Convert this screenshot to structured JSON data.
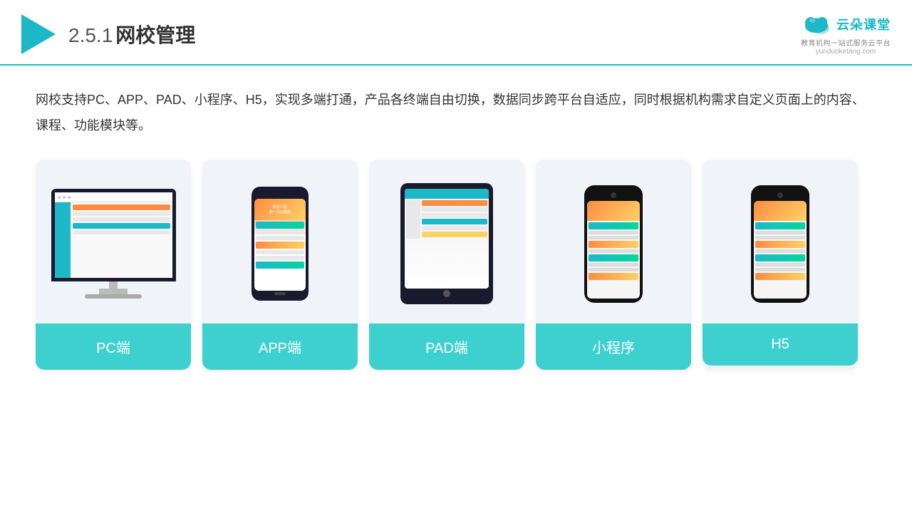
{
  "header": {
    "title": "网校管理",
    "title_number": "2.5.1",
    "logo_text": "云朵课堂",
    "logo_sub": "教育机构一站式服务云平台",
    "logo_url": "yunduoketang.com"
  },
  "description": "网校支持PC、APP、PAD、小程序、H5，实现多端打通，产品各终端自由切换，数据同步跨平台自适应，同时根据机构需求自定义页面上的内容、课程、功能模块等。",
  "cards": [
    {
      "id": "pc",
      "label": "PC端"
    },
    {
      "id": "app",
      "label": "APP端"
    },
    {
      "id": "pad",
      "label": "PAD端"
    },
    {
      "id": "miniprogram",
      "label": "小程序"
    },
    {
      "id": "h5",
      "label": "H5"
    }
  ],
  "colors": {
    "accent": "#1db8c8",
    "card_bg": "#f0f4f8",
    "card_label": "#3ecfcf"
  }
}
